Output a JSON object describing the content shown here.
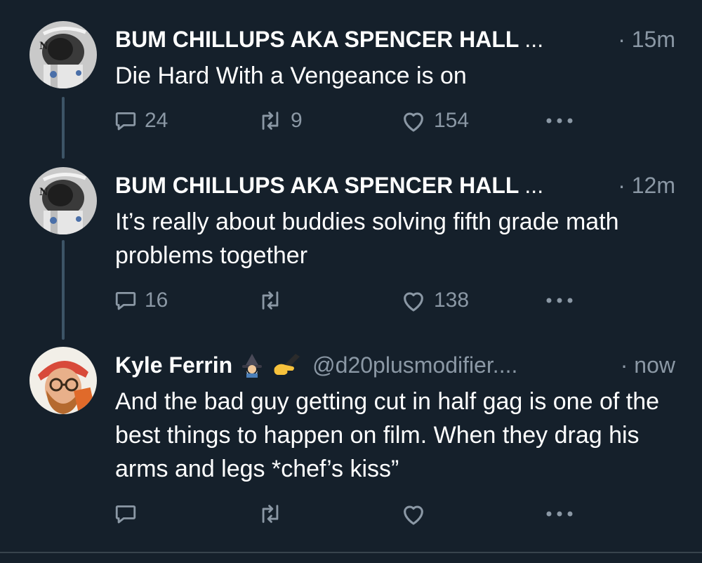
{
  "tweets": [
    {
      "author": "BUM CHILLUPS AKA SPENCER HALL",
      "ellipsis": "...",
      "time": "· 15m",
      "text": "Die Hard With a Vengeance is on",
      "replies": "24",
      "retweets": "9",
      "likes": "154"
    },
    {
      "author": "BUM CHILLUPS AKA SPENCER HALL",
      "ellipsis": "...",
      "time": "· 12m",
      "text": "It’s really about buddies solving fifth grade math problems together",
      "replies": "16",
      "retweets": "",
      "likes": "138"
    },
    {
      "author": "Kyle Ferrin",
      "handle": "@d20plusmodifier....",
      "time": "· now",
      "text": "And the bad guy getting cut in half gag is one of the best things to happen on film. When they drag his arms and legs *chef’s kiss”",
      "replies": "",
      "retweets": "",
      "likes": "",
      "name_emojis": [
        "wizard-emoji",
        "writing-hand-emoji"
      ]
    }
  ],
  "colors": {
    "background": "#15202b",
    "primary_text": "#ffffff",
    "secondary_text": "#8b98a5",
    "thread_line": "#3d5466"
  },
  "icons": [
    "reply-icon",
    "retweet-icon",
    "like-icon",
    "more-icon"
  ]
}
